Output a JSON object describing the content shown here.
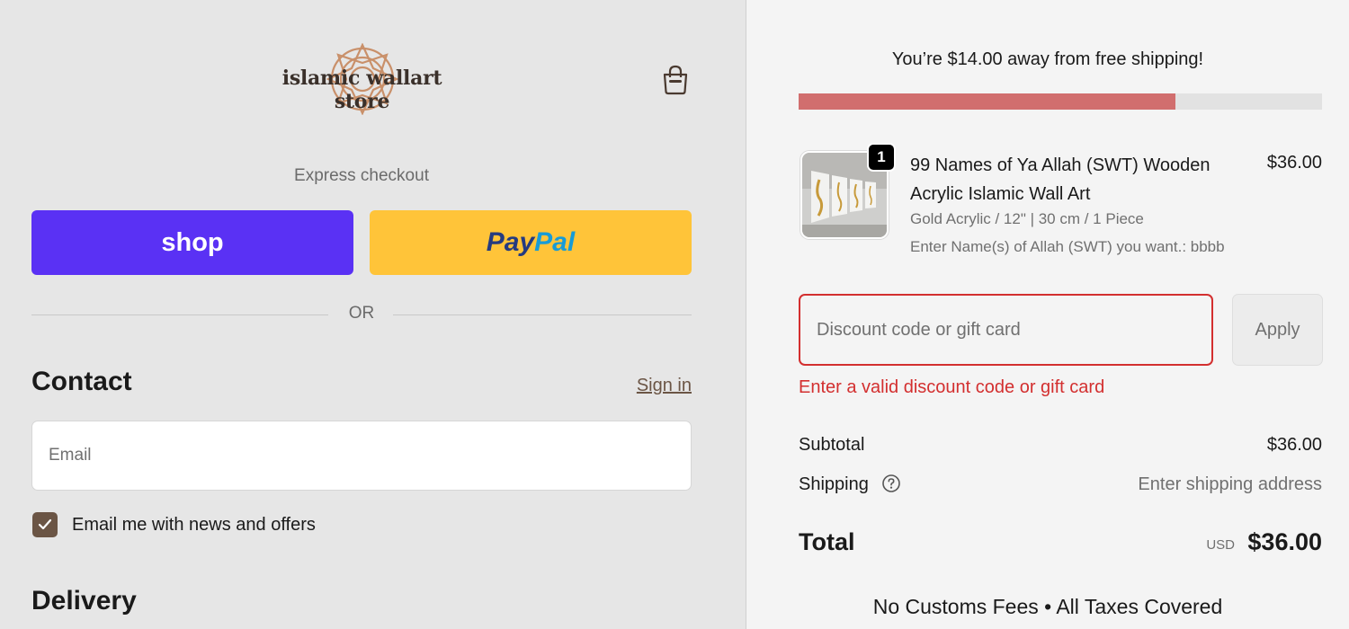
{
  "brand": {
    "logo_text": "islamic wallart store",
    "accent_color": "#c9906a"
  },
  "express_checkout": {
    "label": "Express checkout",
    "shop_label": "shop",
    "paypal_pay": "Pay",
    "paypal_pal": "Pal",
    "or_label": "OR"
  },
  "contact": {
    "title": "Contact",
    "signin_label": "Sign in",
    "email_placeholder": "Email",
    "email_value": "",
    "newsletter_checked": true,
    "newsletter_label": "Email me with news and offers"
  },
  "delivery": {
    "title": "Delivery"
  },
  "summary": {
    "free_shipping_message": "You’re $14.00 away from free shipping!",
    "free_shipping_progress": 0.72,
    "item": {
      "quantity": "1",
      "title": "99 Names of Ya Allah (SWT) Wooden Acrylic Islamic Wall Art",
      "price": "$36.00",
      "variant": "Gold Acrylic / 12\" | 30 cm / 1 Piece",
      "custom_field": "Enter Name(s) of Allah (SWT) you want.: bbbb"
    },
    "discount": {
      "placeholder": "Discount code or gift card",
      "apply_label": "Apply",
      "error": "Enter a valid discount code or gift card"
    },
    "subtotal_label": "Subtotal",
    "subtotal_value": "$36.00",
    "shipping_label": "Shipping",
    "shipping_value": "Enter shipping address",
    "total_label": "Total",
    "total_currency": "USD",
    "total_value": "$36.00",
    "footer_note": "No Customs Fees • All Taxes Covered"
  },
  "colors": {
    "shop_purple": "#5a31f4",
    "paypal_yellow": "#ffc439",
    "progress_red": "#d16e6e",
    "error_red": "#d32f2f",
    "checkbox_brown": "#6b5545"
  }
}
